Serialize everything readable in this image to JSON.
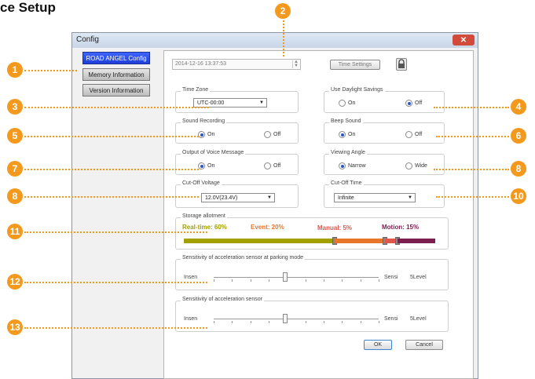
{
  "heading": "ce Setup",
  "window": {
    "title": "Config",
    "close_glyph": "✕"
  },
  "menu": [
    {
      "label": "ROAD ANGEL Config",
      "active": true
    },
    {
      "label": "Memory Information",
      "active": false
    },
    {
      "label": "Version Information",
      "active": false
    }
  ],
  "datetime": {
    "value": "2014-12-16 13:37:53",
    "spin_icon": "spin-up-down-icon",
    "time_settings_label": "Time Settings",
    "lock_icon": "lock-icon"
  },
  "time_zone": {
    "legend": "Time Zone",
    "value": "UTC-00:00"
  },
  "daylight": {
    "legend": "Use Daylight Savings",
    "on": "On",
    "off": "Off",
    "selected": "off"
  },
  "sound_recording": {
    "legend": "Sound Recording",
    "on": "On",
    "off": "Off",
    "selected": "on"
  },
  "beep_sound": {
    "legend": "Beep Sound",
    "on": "On",
    "off": "Off",
    "selected": "on"
  },
  "voice_message": {
    "legend": "Output of Voice Message",
    "on": "On",
    "off": "Off",
    "selected": "on"
  },
  "viewing_angle": {
    "legend": "Viewing Angle",
    "narrow": "Narrow",
    "wide": "Wide",
    "selected": "narrow"
  },
  "cutoff_voltage": {
    "legend": "Cut-Off Voltage",
    "value": "12.0V(23.4V)"
  },
  "cutoff_time": {
    "legend": "Cut-Off Time",
    "value": "Infinite"
  },
  "storage": {
    "legend": "Storage allotment",
    "realtime": {
      "label": "Real-time: 60%",
      "percent": 60,
      "color": "#a1a000"
    },
    "event": {
      "label": "Event: 20%",
      "percent": 20,
      "color": "#e8762a"
    },
    "manual": {
      "label": "Manual: 5%",
      "percent": 5,
      "color": "#e0564a"
    },
    "motion": {
      "label": "Motion: 15%",
      "percent": 15,
      "color": "#7a1f4e"
    }
  },
  "parking_sensor": {
    "legend": "Sensitivity of acceleration sensor at parking mode",
    "min_label": "Insen",
    "max_label": "Sensi",
    "level": "5Level"
  },
  "accel_sensor": {
    "legend": "Sensitivity of acceleration sensor",
    "min_label": "Insen",
    "max_label": "Sensi",
    "level": "5Level"
  },
  "buttons": {
    "ok": "OK",
    "cancel": "Cancel"
  },
  "callouts": [
    "1",
    "2",
    "3",
    "4",
    "5",
    "6",
    "7",
    "8",
    "8",
    "10",
    "11",
    "12",
    "13"
  ],
  "accent_color": "#f39a1e"
}
